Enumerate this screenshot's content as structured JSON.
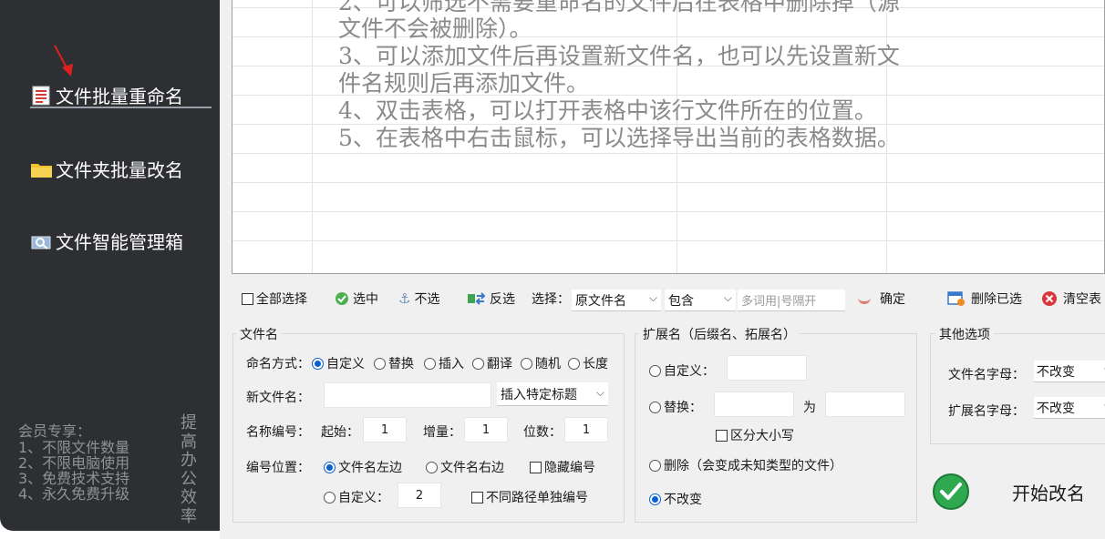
{
  "sidebar": {
    "items": [
      {
        "label": "文件批量重命名",
        "icon": "document-icon"
      },
      {
        "label": "文件夹批量改名",
        "icon": "folder-icon"
      },
      {
        "label": "文件智能管理箱",
        "icon": "toolbox-icon"
      }
    ],
    "promo": {
      "title": "会员专享：",
      "lines": [
        "1、不限文件数量",
        "2、不限电脑使用",
        "3、免费技术支持",
        "4、永久免费升级"
      ],
      "vertical_text": [
        "提",
        "高",
        "办",
        "公",
        "效",
        "率"
      ]
    }
  },
  "instructions": [
    "2、可以筛选不需要重命名的文件后在表格中删除掉（源",
    "文件不会被删除）。",
    "3、可以添加文件后再设置新文件名，也可以先设置新文",
    "件名规则后再添加文件。",
    "4、双击表格，可以打开表格中该行文件所在的位置。",
    "5、在表格中右击鼠标，可以选择导出当前的表格数据。"
  ],
  "toolbar": {
    "select_all": "全部选择",
    "select": "选中",
    "unselect": "不选",
    "invert": "反选",
    "choose_label": "选择：",
    "choose_field": "原文件名",
    "condition": "包含",
    "keyword_placeholder": "多词用|号隔开",
    "confirm": "确定",
    "delete_selected": "删除已选",
    "clear_table": "清空表"
  },
  "filename_group": {
    "title": "文件名",
    "mode_label": "命名方式：",
    "modes": [
      "自定义",
      "替换",
      "插入",
      "翻译",
      "随机",
      "长度"
    ],
    "selected_mode": "自定义",
    "new_name_label": "新文件名：",
    "new_name_value": "",
    "insert_title": "插入特定标题",
    "number_label": "名称编号：",
    "start_label": "起始：",
    "start_value": "1",
    "step_label": "增量：",
    "step_value": "1",
    "digits_label": "位数：",
    "digits_value": "1",
    "position_label": "编号位置：",
    "pos_left": "文件名左边",
    "pos_right": "文件名右边",
    "hide_number": "隐藏编号",
    "pos_custom": "自定义：",
    "pos_custom_value": "2",
    "per_path": "不同路径单独编号"
  },
  "ext_group": {
    "title": "扩展名（后缀名、拓展名）",
    "custom": "自定义：",
    "replace": "替换：",
    "replace_to": "为",
    "case_sensitive": "区分大小写",
    "delete": "删除（会变成未知类型的文件）",
    "unchanged": "不改变",
    "selected": "不改变"
  },
  "other_group": {
    "title": "其他选项",
    "filename_case_label": "文件名字母：",
    "filename_case_value": "不改变",
    "ext_case_label": "扩展名字母：",
    "ext_case_value": "不改变"
  },
  "start_button": "开始改名",
  "colors": {
    "sidebar_bg": "#2d2f33",
    "accent_blue": "#0a5fd0",
    "go_green": "#2fa84f"
  }
}
